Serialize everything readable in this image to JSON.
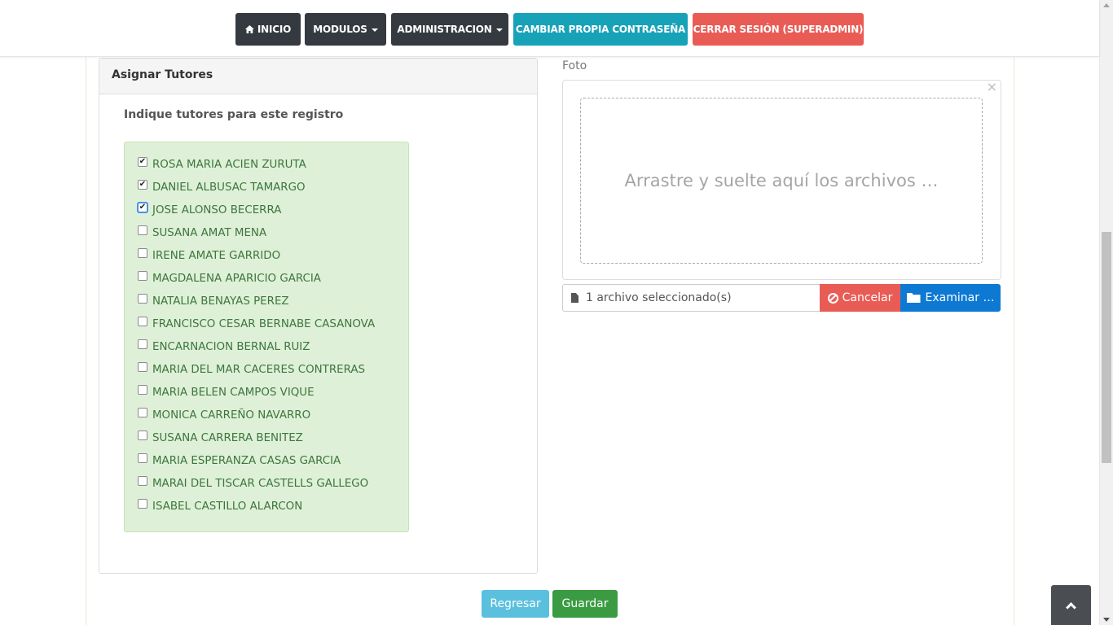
{
  "navbar": {
    "inicio": "INICIO",
    "modulos": "MODULOS",
    "administracion": "ADMINISTRACION",
    "cambiar": "CAMBIAR PROPIA CONTRASEÑA",
    "cerrar": "CERRAR SESIÓN (SUPERADMIN)"
  },
  "panel": {
    "title": "Asignar Tutores",
    "subtitle": "Indique tutores para este registro",
    "tutors": [
      {
        "name": "ROSA MARIA ACIEN ZURUTA",
        "checked": true
      },
      {
        "name": "DANIEL ALBUSAC TAMARGO",
        "checked": true
      },
      {
        "name": "JOSE ALONSO BECERRA",
        "checked": true
      },
      {
        "name": "SUSANA AMAT MENA",
        "checked": false
      },
      {
        "name": "IRENE AMATE GARRIDO",
        "checked": false
      },
      {
        "name": "MAGDALENA APARICIO GARCIA",
        "checked": false
      },
      {
        "name": "NATALIA BENAYAS PEREZ",
        "checked": false
      },
      {
        "name": "FRANCISCO CESAR BERNABE CASANOVA",
        "checked": false
      },
      {
        "name": "ENCARNACION BERNAL RUIZ",
        "checked": false
      },
      {
        "name": "MARIA DEL MAR CACERES CONTRERAS",
        "checked": false
      },
      {
        "name": "MARIA BELEN CAMPOS VIQUE",
        "checked": false
      },
      {
        "name": "MONICA CARREÑO NAVARRO",
        "checked": false
      },
      {
        "name": "SUSANA CARRERA BENITEZ",
        "checked": false
      },
      {
        "name": "MARIA ESPERANZA CASAS GARCIA",
        "checked": false
      },
      {
        "name": "MARAI DEL TISCAR CASTELLS GALLEGO",
        "checked": false
      },
      {
        "name": "ISABEL CASTILLO ALARCON",
        "checked": false
      }
    ]
  },
  "foto": {
    "label": "Foto",
    "close": "×",
    "drop_text": "Arrastre y suelte aquí los archivos …",
    "caption": "1 archivo seleccionado(s)",
    "cancel": "Cancelar",
    "browse": "Examinar …"
  },
  "buttons": {
    "back": "Regresar",
    "save": "Guardar"
  }
}
